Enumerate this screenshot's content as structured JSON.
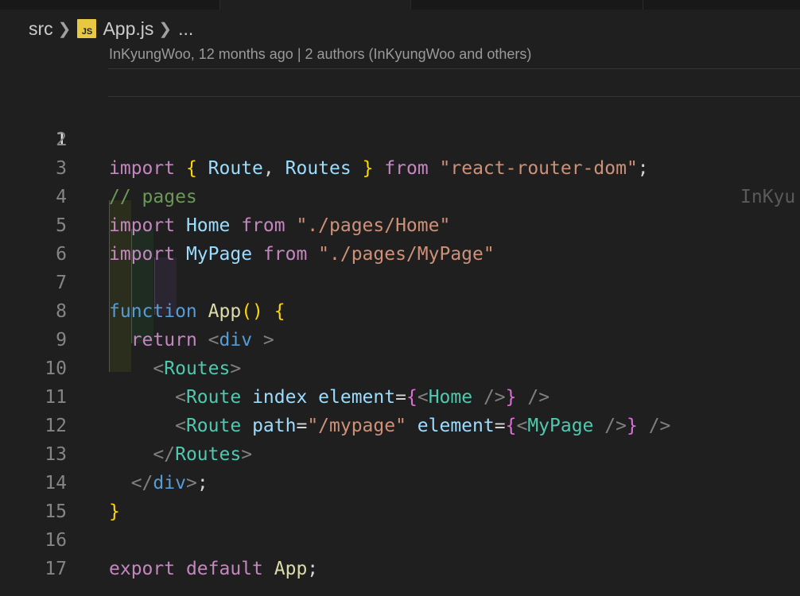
{
  "breadcrumb": {
    "folder": "src",
    "file_icon": "JS",
    "file": "App.js",
    "more": "..."
  },
  "blame_lens": "InKyungWoo, 12 months ago | 2 authors (InKyungWoo and others)",
  "inline_blame": "InKyu",
  "colors": {
    "background": "#1f1f1f",
    "keyword": "#c586c0",
    "declaration": "#569cd6",
    "identifier": "#9cdcfe",
    "function": "#dcdcaa",
    "string": "#ce9178",
    "comment": "#6a9955",
    "component_tag": "#4ec9b0",
    "bracket_gold": "#ffd700",
    "bracket_purple": "#da70d6"
  },
  "lines": {
    "n1": "1",
    "n2": "2",
    "n3": "3",
    "n4": "4",
    "n5": "5",
    "n6": "6",
    "n7": "7",
    "n8": "8",
    "n9": "9",
    "n10": "10",
    "n11": "11",
    "n12": "12",
    "n13": "13",
    "n14": "14",
    "n15": "15",
    "n16": "16",
    "n17": "17"
  },
  "tokens": {
    "import": "import",
    "from": "from",
    "return": "return",
    "export": "export",
    "default": "default",
    "function": "function",
    "route": "Route",
    "routes": "Routes",
    "home": "Home",
    "mypage": "MyPage",
    "app": "App",
    "div": "div",
    "index": "index",
    "element": "element",
    "path": "path",
    "str_router": "\"react-router-dom\"",
    "str_home": "\"./pages/Home\"",
    "str_mypage": "\"./pages/MyPage\"",
    "str_path": "\"/mypage\"",
    "comment_pages": "// pages"
  }
}
